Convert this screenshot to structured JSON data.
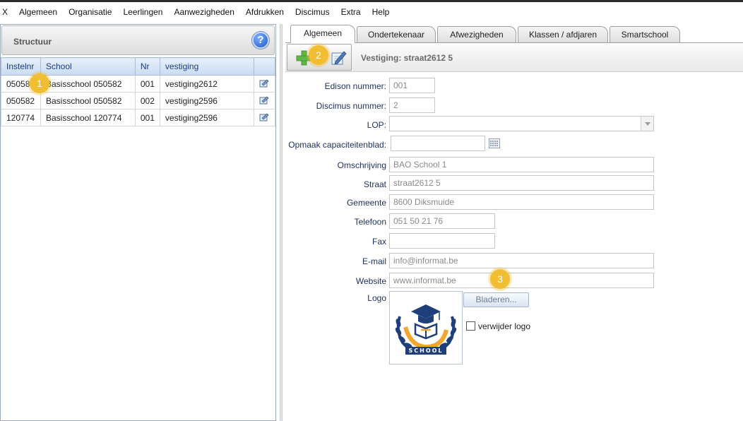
{
  "menu": [
    "X",
    "Algemeen",
    "Organisatie",
    "Leerlingen",
    "Aanwezigheden",
    "Afdrukken",
    "Discimus",
    "Extra",
    "Help"
  ],
  "structure_panel": {
    "title": "Structuur",
    "help_glyph": "?",
    "columns": [
      "Instelnr",
      "School",
      "Nr",
      "vestiging"
    ],
    "rows": [
      {
        "instelnr": "050582",
        "school": "Basisschool 050582",
        "nr": "001",
        "vestiging": "vestiging2612"
      },
      {
        "instelnr": "050582",
        "school": "Basisschool 050582",
        "nr": "002",
        "vestiging": "vestiging2596"
      },
      {
        "instelnr": "120774",
        "school": "Basisschool 120774",
        "nr": "001",
        "vestiging": "vestiging2596"
      }
    ]
  },
  "tabs": [
    "Algemeen",
    "Ondertekenaar",
    "Afwezigheden",
    "Klassen / afdjaren",
    "Smartschool"
  ],
  "active_tab": "Algemeen",
  "toolbar": {
    "title": "Vestiging: straat2612 5"
  },
  "form": {
    "edison_label": "Edison nummer:",
    "edison_value": "001",
    "discimus_label": "Discimus nummer:",
    "discimus_value": "2",
    "lop_label": "LOP:",
    "lop_value": "",
    "opmaak_label": "Opmaak capaciteitenblad:",
    "opmaak_value": "",
    "omschrijving_label": "Omschrijving",
    "omschrijving_value": "BAO School 1",
    "straat_label": "Straat",
    "straat_value": "straat2612 5",
    "gemeente_label": "Gemeente",
    "gemeente_value": "8600 Diksmuide",
    "telefoon_label": "Telefoon",
    "telefoon_value": "051 50 21 76",
    "fax_label": "Fax",
    "fax_value": "",
    "email_label": "E-mail",
    "email_value": "info@informat.be",
    "website_label": "Website",
    "website_value": "www.informat.be",
    "logo_label": "Logo",
    "browse_label": "Bladeren...",
    "remove_logo_label": "verwijder logo",
    "logo_text": "SCHOOL"
  },
  "badges": [
    "1",
    "2",
    "3"
  ],
  "colors": {
    "badge": "#f1bd32",
    "header_text": "#1b3d7a",
    "label_text": "#1d2f5c",
    "logo_navy": "#1f3f7a",
    "logo_orange": "#f2a531"
  }
}
